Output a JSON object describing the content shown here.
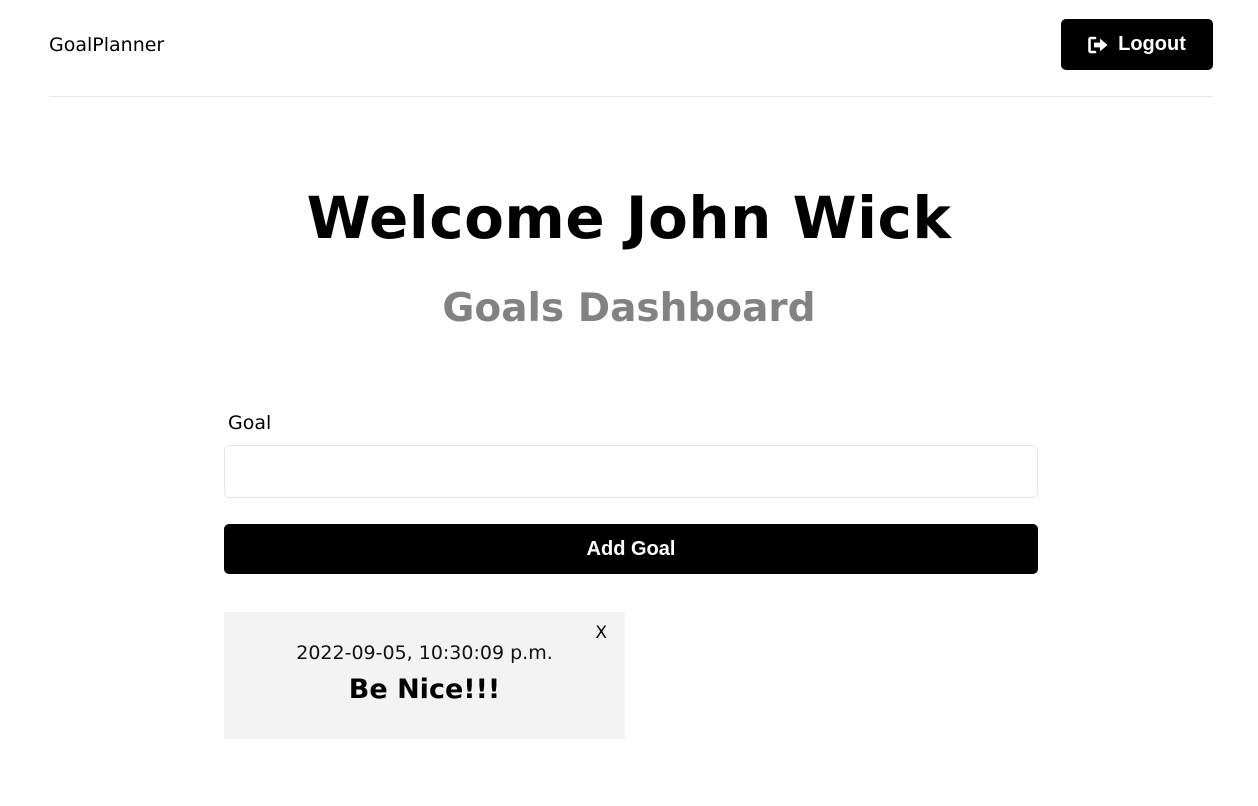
{
  "header": {
    "brand": "GoalPlanner",
    "logout_label": "Logout",
    "logout_icon": "sign-out-icon"
  },
  "main": {
    "welcome": "Welcome John Wick",
    "subtitle": "Goals Dashboard",
    "form": {
      "goal_label": "Goal",
      "goal_value": "",
      "goal_placeholder": "",
      "add_label": "Add Goal"
    },
    "goals": [
      {
        "date": "2022-09-05, 10:30:09 p.m.",
        "text": "Be Nice!!!",
        "close_label": "X"
      }
    ]
  },
  "colors": {
    "accent": "#000000",
    "subtitle": "#828282",
    "card_bg": "#f3f3f3",
    "divider": "#e6e6e6"
  }
}
